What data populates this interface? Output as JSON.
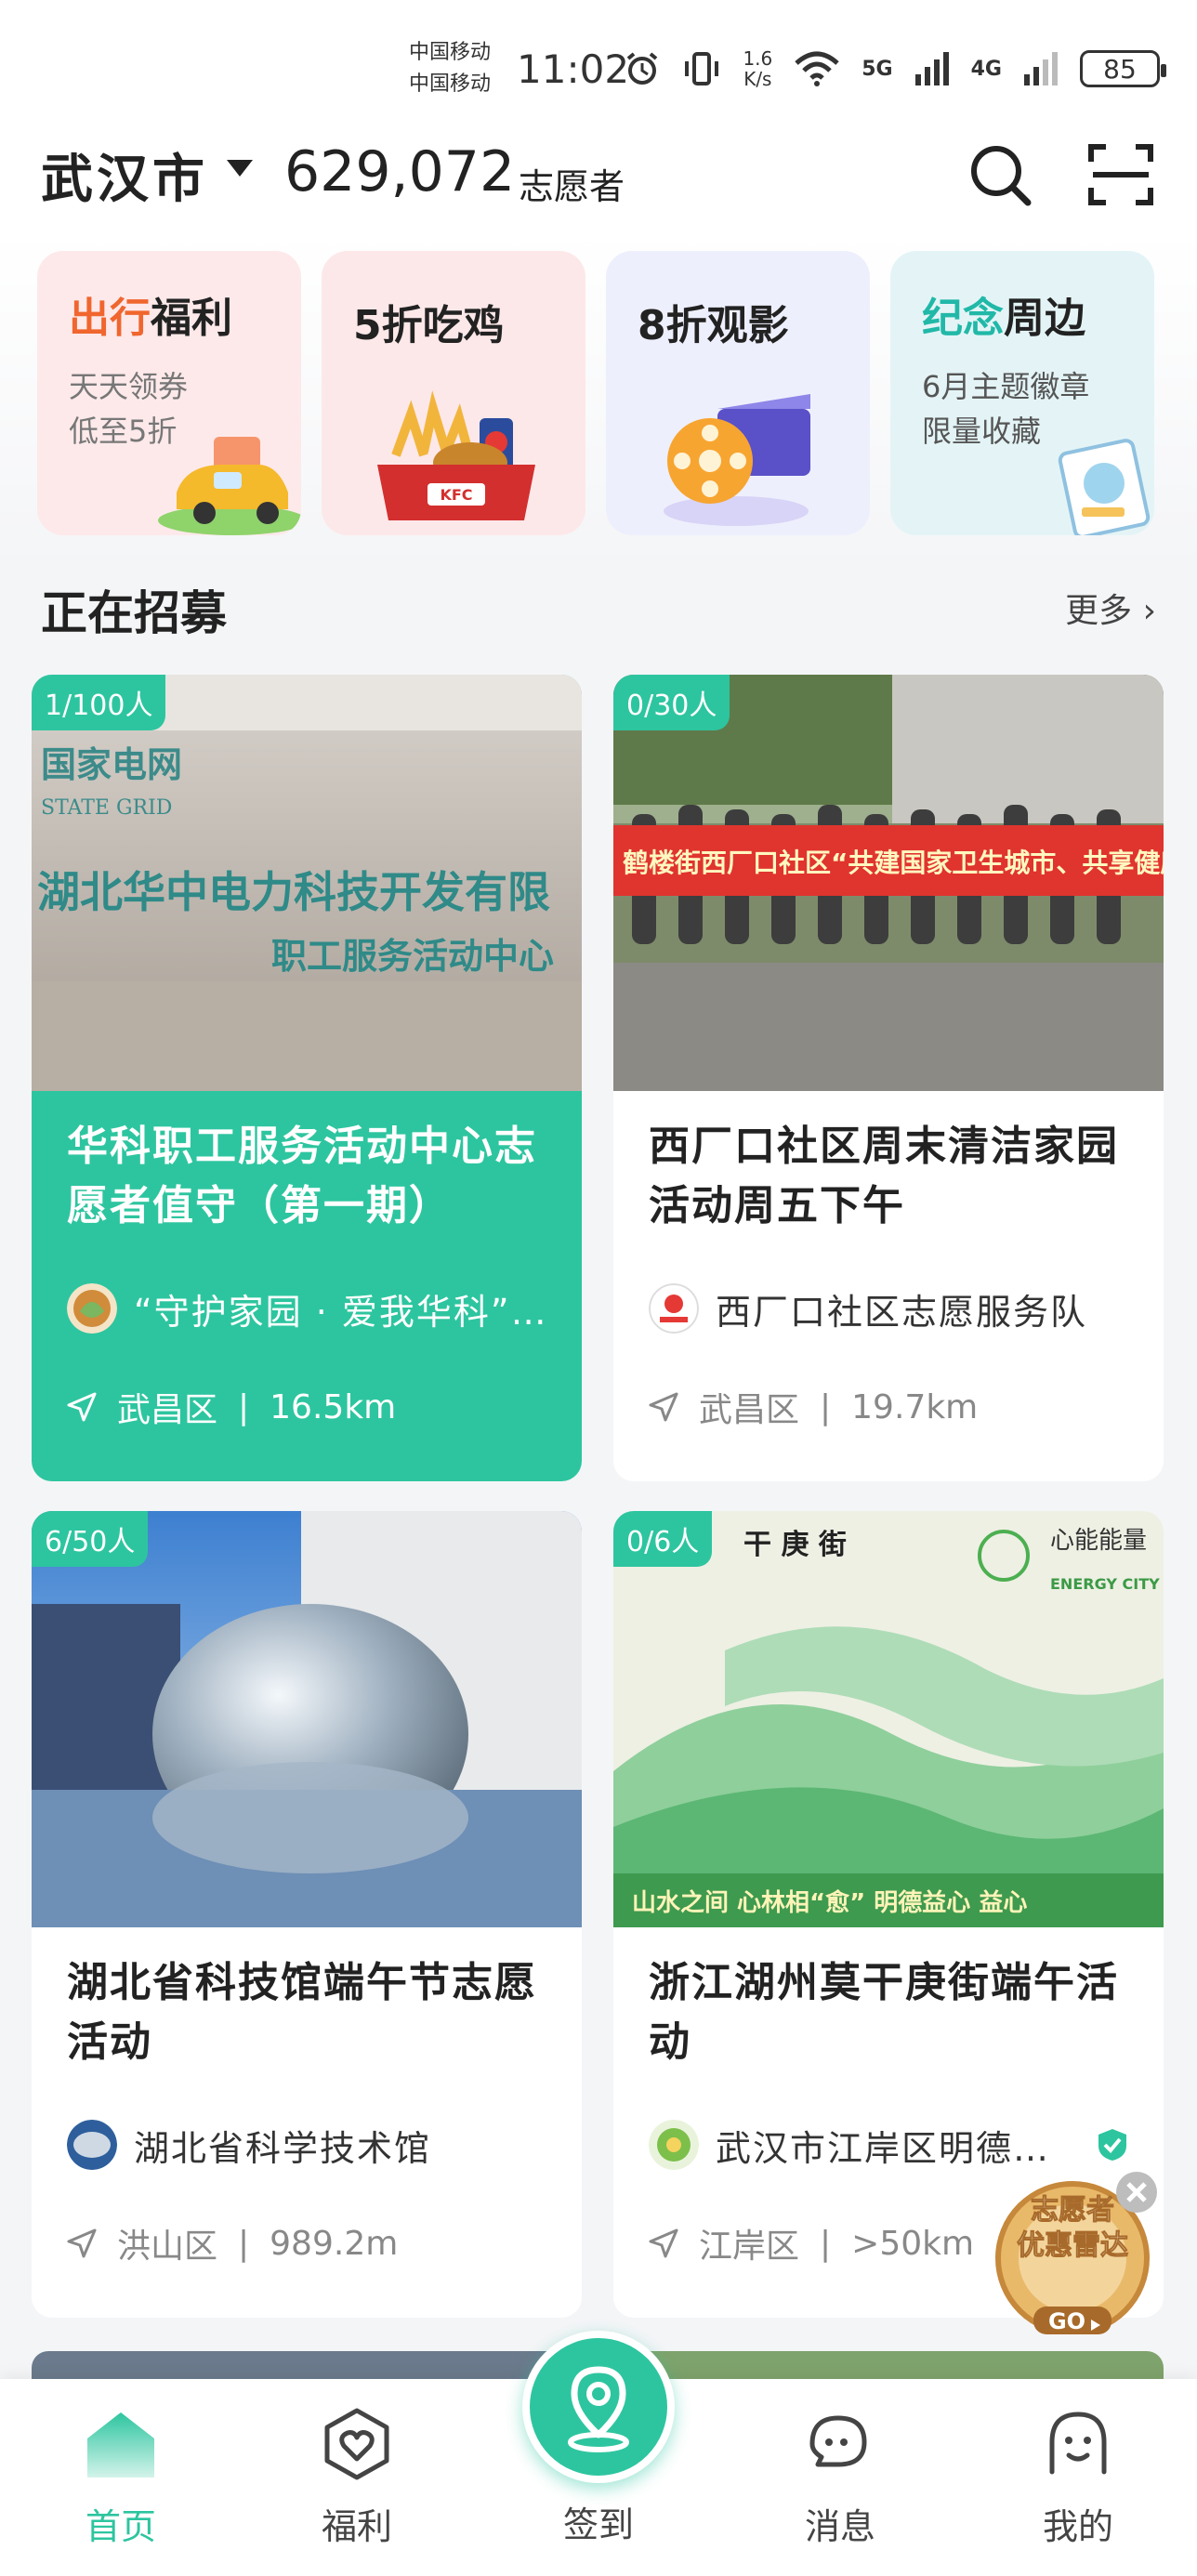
{
  "status_bar": {
    "carrier_1": "中国移动",
    "carrier_2": "中国移动",
    "time": "11:02",
    "speed_value": "1.6",
    "speed_unit": "K/s",
    "net_1": "5G",
    "net_2": "4G",
    "battery": "85"
  },
  "header": {
    "city": "武汉市",
    "volunteer_count": "629,072",
    "volunteer_label": "志愿者"
  },
  "promos": [
    {
      "title_a": "出行",
      "title_b": "福利",
      "subtitle": "天天领券\n低至5折",
      "bg": "#fde9ea",
      "accent": "#f0662e"
    },
    {
      "title": "5折吃鸡",
      "bg": "#fde8e9"
    },
    {
      "title": "8折观影",
      "bg": "#eeeffc"
    },
    {
      "title_a": "纪念",
      "title_b": "周边",
      "subtitle": "6月主题徽章\n限量收藏",
      "bg": "#e4f4f6",
      "accent": "#21b8a8"
    }
  ],
  "recruiting": {
    "section_title": "正在招募",
    "more_label": "更多",
    "cards": [
      {
        "quota": "1/100人",
        "title": "华科职工服务活动中心志愿者值守（第一期）",
        "org": "“守护家园 · 爱我华科”志愿服务队",
        "district": "武昌区",
        "distance": "16.5km",
        "photo_text_1": "国家电网",
        "photo_text_2": "STATE GRID",
        "photo_text_3": "湖北华中电力科技开发有限",
        "photo_text_4": "职工服务活动中心"
      },
      {
        "quota": "0/30人",
        "title": "西厂口社区周末清洁家园活动周五下午",
        "org": "西厂口社区志愿服务队",
        "district": "武昌区",
        "distance": "19.7km",
        "photo_text_1": "鹤楼街西厂口社区“共建国家卫生城市、共享健康文明武昌”清洁"
      },
      {
        "quota": "6/50人",
        "title": "湖北省科技馆端午节志愿活动",
        "org": "湖北省科学技术馆",
        "district": "洪山区",
        "distance": "989.2m"
      },
      {
        "quota": "0/6人",
        "title": "浙江湖州莫干庚街端午活动",
        "org": "武汉市江岸区明德益心志愿服务队",
        "district": "江岸区",
        "distance": ">50km",
        "photo_text_1": "干 庚 街",
        "photo_text_2": "心能能量",
        "photo_text_3": "ENERGY CITY",
        "photo_text_4": "山水之间  心林相“愈”  明德益心  益心"
      }
    ]
  },
  "radar_badge": {
    "line_1": "志愿者",
    "line_2": "优惠雷达",
    "go": "GO"
  },
  "bottom_nav": {
    "items": [
      {
        "label": "首页"
      },
      {
        "label": "福利"
      },
      {
        "label": "签到"
      },
      {
        "label": "消息"
      },
      {
        "label": "我的"
      }
    ]
  },
  "colors": {
    "brand": "#2dc59f",
    "text": "#222222",
    "muted": "#888888"
  }
}
